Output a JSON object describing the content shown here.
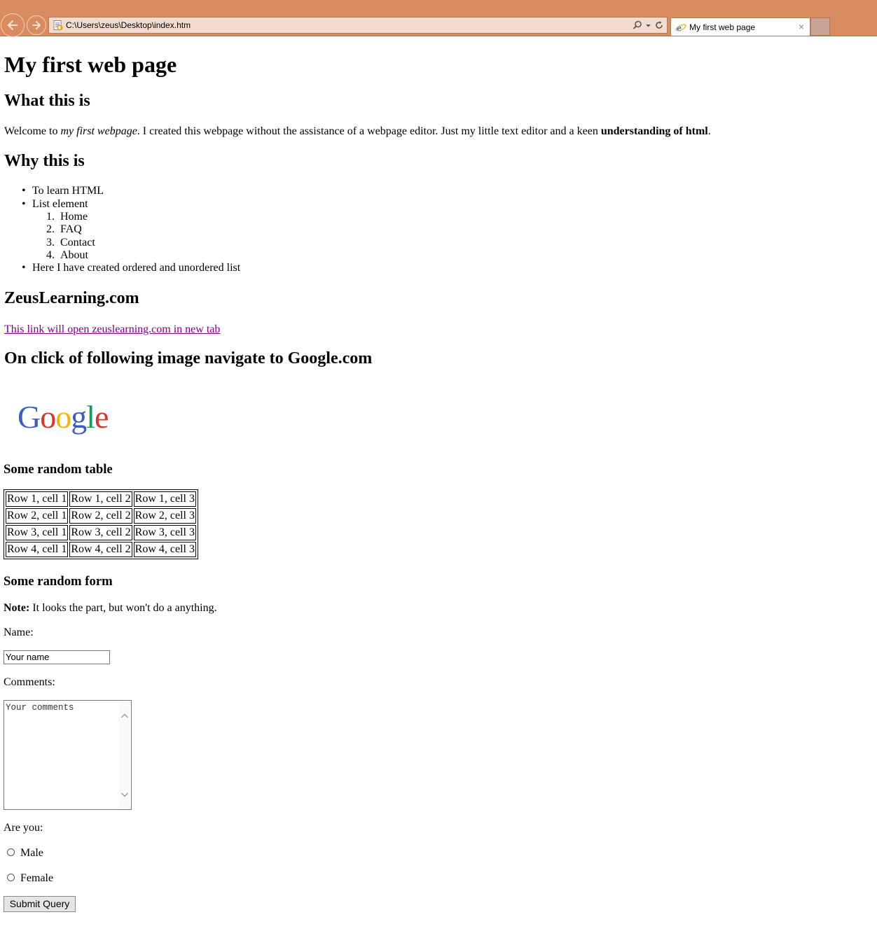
{
  "browser": {
    "address": "C:\\Users\\zeus\\Desktop\\index.htm",
    "tab_title": "My first web page",
    "tab_close": "×",
    "icons": [
      "back-arrow-icon",
      "forward-arrow-icon",
      "page-favicon-icon",
      "search-icon",
      "dropdown-arrow-icon",
      "refresh-icon",
      "ie-logo-icon",
      "close-icon"
    ]
  },
  "page": {
    "h1": "My first web page",
    "section1": {
      "heading": "What this is",
      "text_a": "Welcome to ",
      "text_em": "my first webpage",
      "text_b": ". I created this webpage without the assistance of a webpage editor. Just my little text editor and a keen ",
      "text_strong": "understanding of html",
      "text_c": "."
    },
    "section2": {
      "heading": "Why this is",
      "items": [
        "To learn HTML",
        "List element",
        "Here I have created ordered and unordered list"
      ],
      "sub_items": [
        {
          "num": "1.",
          "label": "Home"
        },
        {
          "num": "2.",
          "label": "FAQ"
        },
        {
          "num": "3.",
          "label": "Contact"
        },
        {
          "num": "4.",
          "label": "About"
        }
      ]
    },
    "section3": {
      "heading": "ZeusLearning.com",
      "link": "This link will open zeuslearning.com in new tab"
    },
    "section4": {
      "heading": "On click of following image navigate to Google.com",
      "logo_text": "Google",
      "logo_colors": [
        "#3b5fc5",
        "#d6372a",
        "#f4b400",
        "#3b5fc5",
        "#109d58",
        "#d6372a"
      ]
    },
    "table": {
      "heading": "Some random table",
      "rows": [
        [
          "Row 1, cell 1",
          "Row 1, cell 2",
          "Row 1, cell 3"
        ],
        [
          "Row 2, cell 1",
          "Row 2, cell 2",
          "Row 2, cell 3"
        ],
        [
          "Row 3, cell 1",
          "Row 3, cell 2",
          "Row 3, cell 3"
        ],
        [
          "Row 4, cell 1",
          "Row 4, cell 2",
          "Row 4, cell 3"
        ]
      ]
    },
    "form": {
      "heading": "Some random form",
      "note_label": "Note:",
      "note_text": " It looks the part, but won't do a anything.",
      "name_label": "Name:",
      "name_value": "Your name",
      "comments_label": "Comments:",
      "comments_value": "Your comments",
      "are_you_label": "Are you:",
      "radio_male": "Male",
      "radio_female": "Female",
      "submit_label": "Submit Query"
    }
  },
  "colors": {
    "chrome": "#d98c60",
    "link_visited": "#800080"
  }
}
